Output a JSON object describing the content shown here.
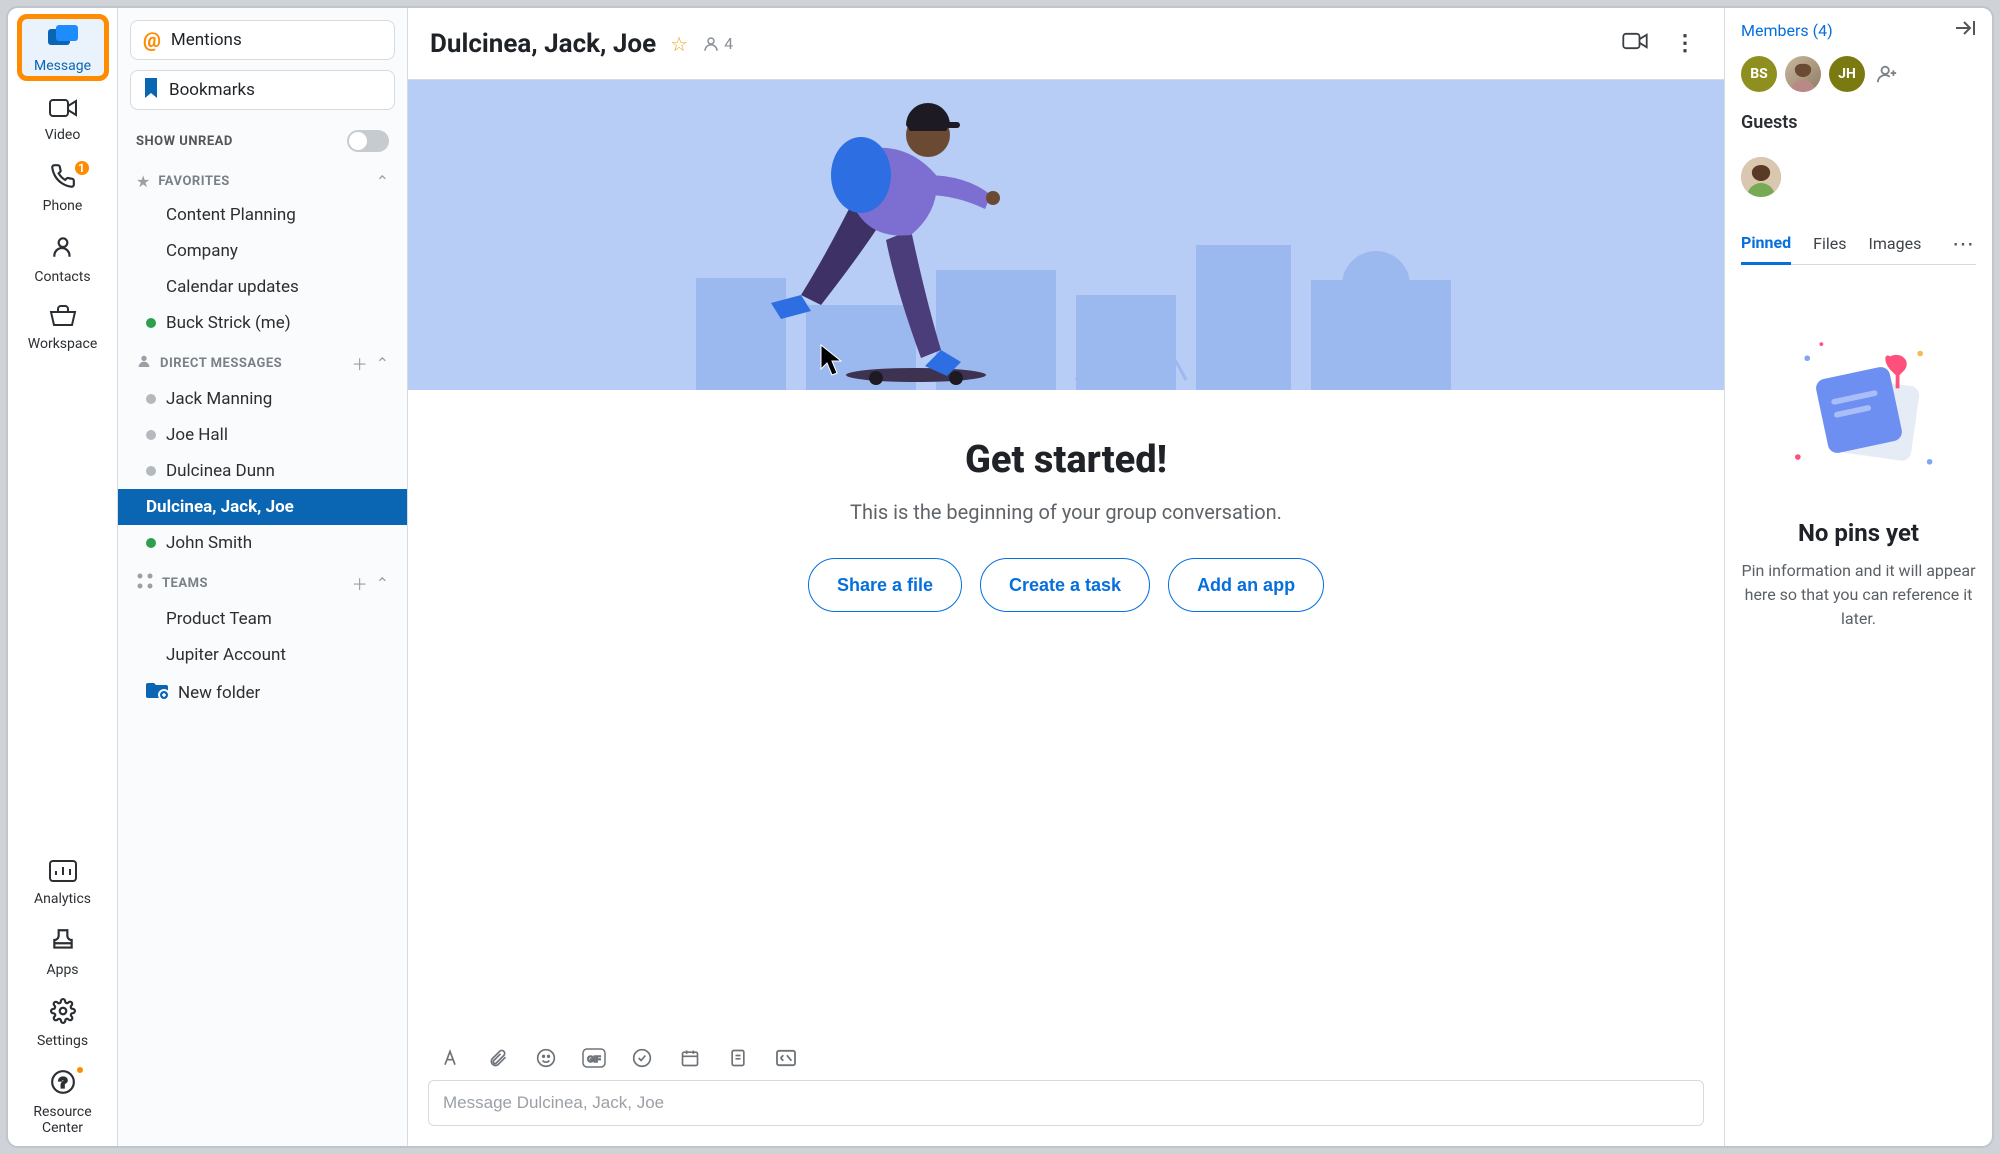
{
  "navrail": {
    "items": [
      {
        "key": "message",
        "label": "Message",
        "icon": "message-icon",
        "active": true
      },
      {
        "key": "video",
        "label": "Video",
        "icon": "video-icon"
      },
      {
        "key": "phone",
        "label": "Phone",
        "icon": "phone-icon",
        "badge": "1"
      },
      {
        "key": "contacts",
        "label": "Contacts",
        "icon": "contacts-icon"
      },
      {
        "key": "workspace",
        "label": "Workspace",
        "icon": "workspace-icon"
      }
    ],
    "bottom": [
      {
        "key": "analytics",
        "label": "Analytics",
        "icon": "analytics-icon"
      },
      {
        "key": "apps",
        "label": "Apps",
        "icon": "apps-icon"
      },
      {
        "key": "settings",
        "label": "Settings",
        "icon": "settings-icon"
      },
      {
        "key": "resource",
        "label": "Resource Center",
        "icon": "resource-center-icon",
        "dot": true
      }
    ]
  },
  "convlist": {
    "mentions_label": "Mentions",
    "bookmarks_label": "Bookmarks",
    "show_unread_label": "SHOW UNREAD",
    "show_unread_on": false,
    "sections": {
      "favorites": {
        "title": "FAVORITES",
        "items": [
          {
            "label": "Content Planning"
          },
          {
            "label": "Company"
          },
          {
            "label": "Calendar updates"
          },
          {
            "label": "Buck Strick (me)",
            "presence": "online"
          }
        ]
      },
      "dm": {
        "title": "DIRECT MESSAGES",
        "items": [
          {
            "label": "Jack Manning",
            "presence": "offline"
          },
          {
            "label": "Joe Hall",
            "presence": "offline"
          },
          {
            "label": "Dulcinea Dunn",
            "presence": "offline"
          },
          {
            "label": "Dulcinea, Jack, Joe",
            "active": true
          },
          {
            "label": "John Smith",
            "presence": "online"
          }
        ]
      },
      "teams": {
        "title": "TEAMS",
        "items": [
          {
            "label": "Product Team"
          },
          {
            "label": "Jupiter Account"
          }
        ],
        "new_folder_label": "New folder"
      }
    }
  },
  "chat": {
    "title": "Dulcinea, Jack, Joe",
    "member_count": "4",
    "welcome_title": "Get started!",
    "welcome_sub": "This is the beginning of your group conversation.",
    "cta": {
      "share": "Share a file",
      "task": "Create a task",
      "app": "Add an app"
    },
    "composer_placeholder": "Message Dulcinea, Jack, Joe"
  },
  "rightpanel": {
    "members_link": "Members (4)",
    "avatars": [
      {
        "initials": "BS",
        "kind": "bs"
      },
      {
        "initials": "",
        "kind": "photo"
      },
      {
        "initials": "JH",
        "kind": "jh"
      }
    ],
    "guests_title": "Guests",
    "tabs": {
      "pinned": "Pinned",
      "files": "Files",
      "images": "Images"
    },
    "empty_title": "No pins yet",
    "empty_text": "Pin information and it will appear here so that you can reference it later."
  }
}
